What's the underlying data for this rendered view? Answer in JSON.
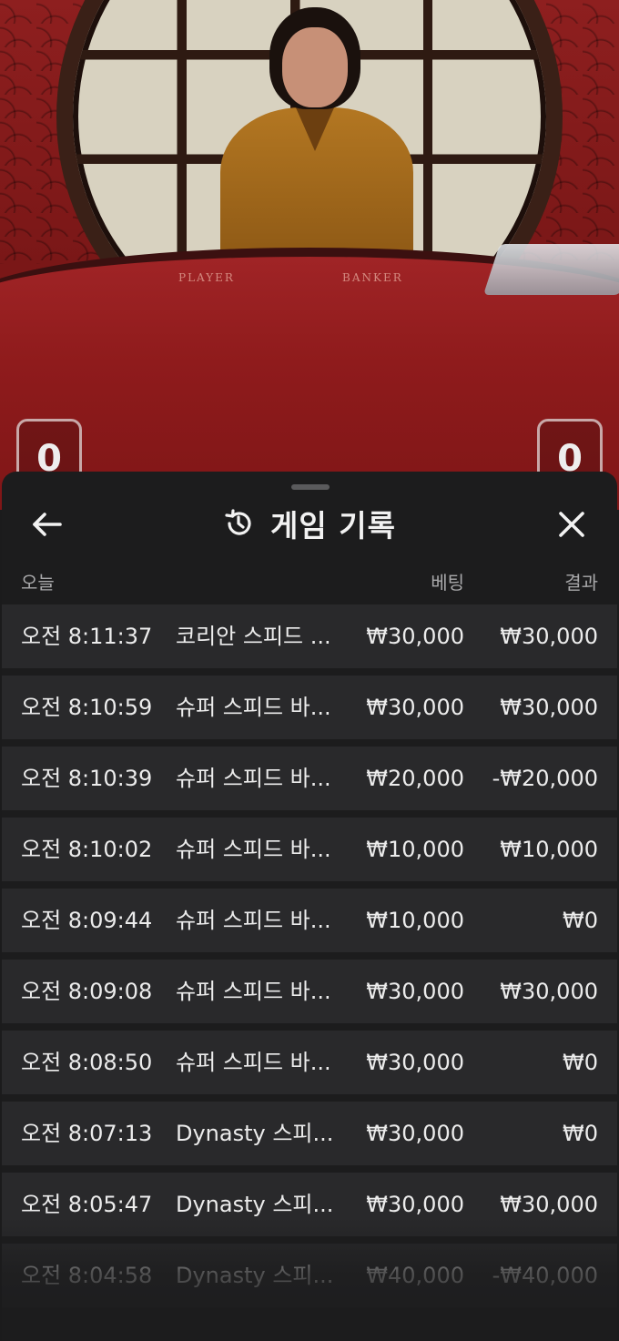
{
  "video": {
    "table_labels": {
      "player": "PLAYER",
      "banker": "BANKER"
    },
    "player_score": "0",
    "banker_score": "0"
  },
  "header": {
    "title": "게임 기록",
    "back_icon": "arrow-left-icon",
    "history_icon": "history-clock-icon",
    "close_icon": "close-icon"
  },
  "columns": {
    "date": "오늘",
    "bet": "베팅",
    "result": "결과"
  },
  "rows": [
    {
      "time": "오전 8:11:37",
      "game": "코리안 스피드 ...",
      "bet": "₩30,000",
      "result": "₩30,000"
    },
    {
      "time": "오전 8:10:59",
      "game": "슈퍼 스피드 바...",
      "bet": "₩30,000",
      "result": "₩30,000"
    },
    {
      "time": "오전 8:10:39",
      "game": "슈퍼 스피드 바...",
      "bet": "₩20,000",
      "result": "-₩20,000"
    },
    {
      "time": "오전 8:10:02",
      "game": "슈퍼 스피드 바...",
      "bet": "₩10,000",
      "result": "₩10,000"
    },
    {
      "time": "오전 8:09:44",
      "game": "슈퍼 스피드 바...",
      "bet": "₩10,000",
      "result": "₩0"
    },
    {
      "time": "오전 8:09:08",
      "game": "슈퍼 스피드 바...",
      "bet": "₩30,000",
      "result": "₩30,000"
    },
    {
      "time": "오전 8:08:50",
      "game": "슈퍼 스피드 바...",
      "bet": "₩30,000",
      "result": "₩0"
    },
    {
      "time": "오전 8:07:13",
      "game": "Dynasty 스피...",
      "bet": "₩30,000",
      "result": "₩0"
    },
    {
      "time": "오전 8:05:47",
      "game": "Dynasty 스피...",
      "bet": "₩30,000",
      "result": "₩30,000"
    },
    {
      "time": "오전 8:04:58",
      "game": "Dynasty 스피...",
      "bet": "₩40,000",
      "result": "-₩40,000"
    }
  ],
  "colors": {
    "sheet_bg": "#1c1c1d",
    "row_bg": "#29292b",
    "text": "#ececec",
    "muted": "#a9a9ab",
    "felt": "#8f1b1c"
  }
}
